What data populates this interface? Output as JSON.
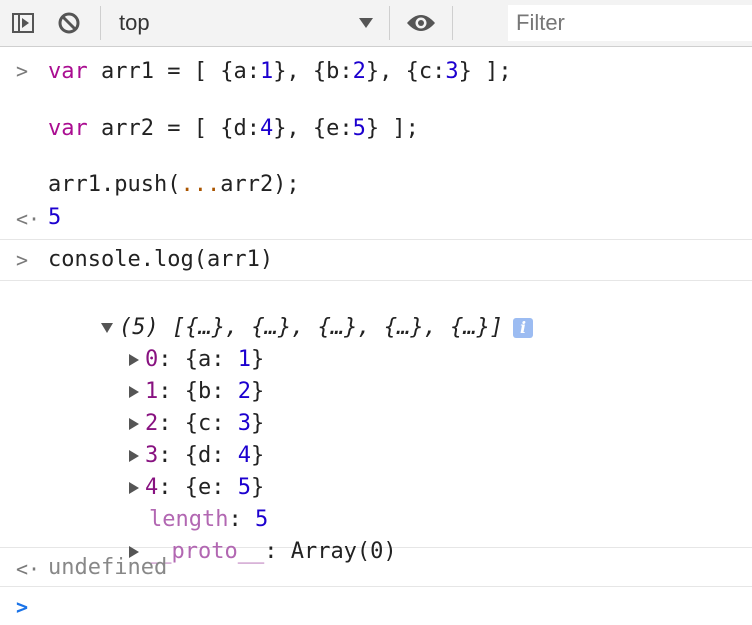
{
  "toolbar": {
    "context": "top",
    "filter_placeholder": "Filter"
  },
  "input1": {
    "l1_var": "var",
    "l1_name": " arr1 = [ {a:",
    "l1_n1": "1",
    "l1_mid1": "}, {b:",
    "l1_n2": "2",
    "l1_mid2": "}, {c:",
    "l1_n3": "3",
    "l1_end": "} ];",
    "l2_var": "var",
    "l2_name": " arr2 = [ {d:",
    "l2_n1": "4",
    "l2_mid1": "}, {e:",
    "l2_n2": "5",
    "l2_end": "} ];",
    "l3_a": "arr1.push(",
    "l3_spread": "...",
    "l3_b": "arr2);"
  },
  "result1": "5",
  "input2": "console.log(arr1)",
  "log": {
    "summary": "(5) [{…}, {…}, {…}, {…}, {…}]",
    "info": "i",
    "items": [
      {
        "key": "0",
        "prop": "a",
        "val": "1"
      },
      {
        "key": "1",
        "prop": "b",
        "val": "2"
      },
      {
        "key": "2",
        "prop": "c",
        "val": "3"
      },
      {
        "key": "3",
        "prop": "d",
        "val": "4"
      },
      {
        "key": "4",
        "prop": "e",
        "val": "5"
      }
    ],
    "length_key": "length",
    "length_val": "5",
    "proto_key": "__proto__",
    "proto_val": "Array(0)"
  },
  "result2": "undefined",
  "colors": {
    "keyword": "#aa0d91",
    "number": "#1c00cf",
    "prompt_active": "#1a73e8"
  }
}
